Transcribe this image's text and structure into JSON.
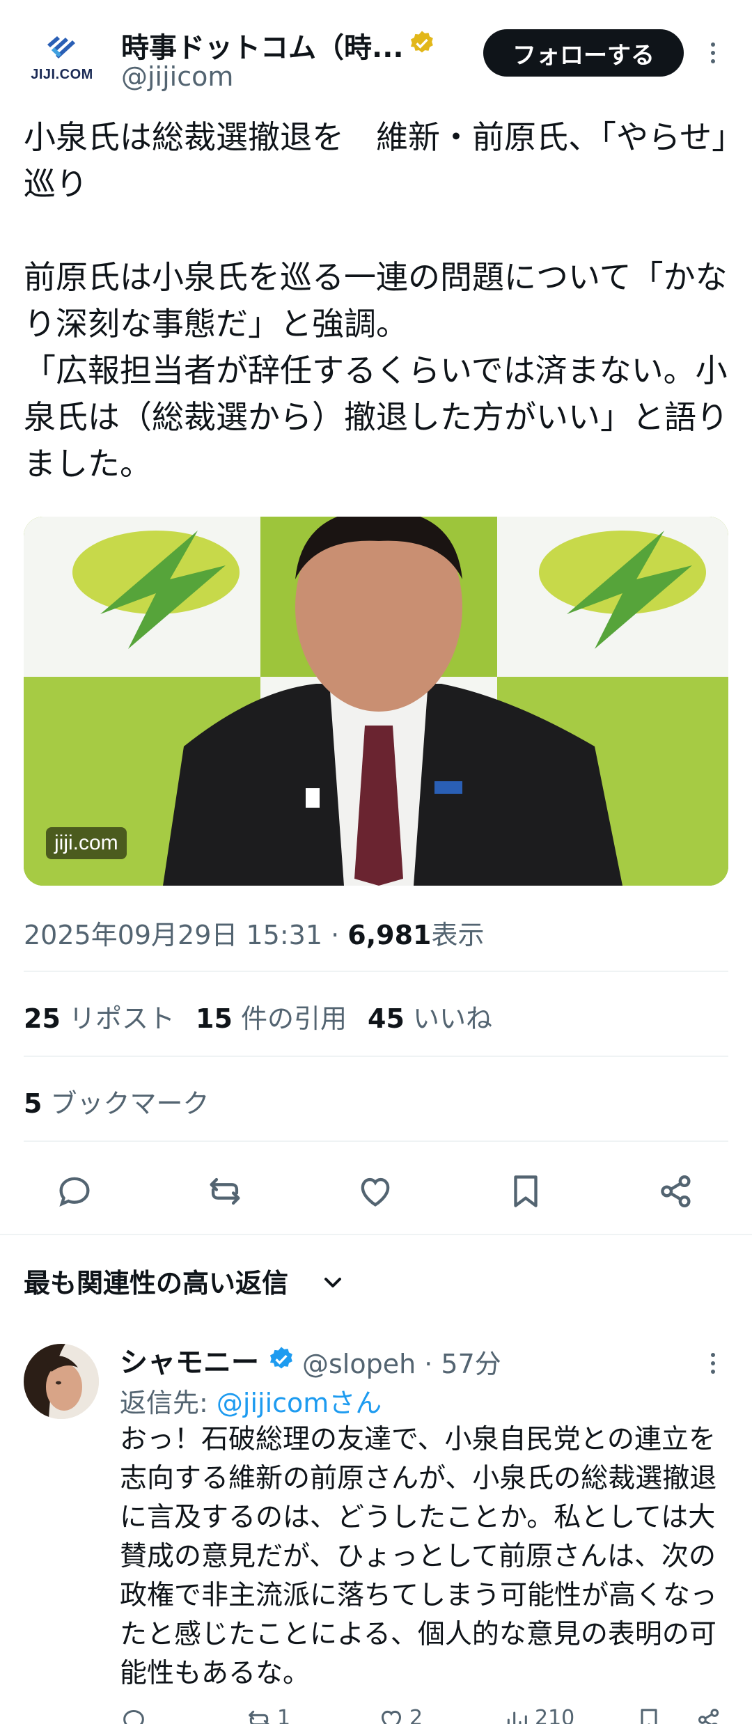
{
  "author": {
    "logo_text": "JIJI.COM",
    "name": "時事ドットコム（時...",
    "handle": "@jijicom",
    "follow_label": "フォローする"
  },
  "tweet": {
    "text": "小泉氏は総裁選撤退を　維新・前原氏、「やらせ」巡り\n\n前原氏は小泉氏を巡る一連の問題について「かなり深刻な事態だ」と強調。\n「広報担当者が辞任するくらいでは済まない。小泉氏は（総裁選から）撤退した方がいい」と語りました。",
    "media_badge": "jiji.com",
    "timestamp": "2025年09月29日 15:31",
    "views_count": "6,981",
    "views_label": "表示"
  },
  "stats": {
    "reposts_count": "25",
    "reposts_label": "リポスト",
    "quotes_count": "15",
    "quotes_label": "件の引用",
    "likes_count": "45",
    "likes_label": "いいね",
    "bookmarks_count": "5",
    "bookmarks_label": "ブックマーク"
  },
  "replies_header": "最も関連性の高い返信",
  "reply": {
    "name": "シャモニー",
    "handle": "@slopeh · 57分",
    "reply_to_label": "返信先: ",
    "reply_to_handle": "@jijicomさん",
    "text": "おっ！石破総理の友達で、小泉自民党との連立を志向する維新の前原さんが、小泉氏の総裁選撤退に言及するのは、どうしたことか。私としては大賛成の意見だが、ひょっとして前原さんは、次の政権で非主流派に落ちてしまう可能性が高くなったと感じたことによる、個人的な意見の表明の可能性もあるな。",
    "reposts": "1",
    "likes": "2",
    "views": "210"
  },
  "colors": {
    "text_primary": "#0f1419",
    "text_secondary": "#536471",
    "link": "#1d9bf0",
    "verified_gold": "#e2b719",
    "verified_blue": "#1d9bf0",
    "follow_bg": "#0f1419"
  }
}
